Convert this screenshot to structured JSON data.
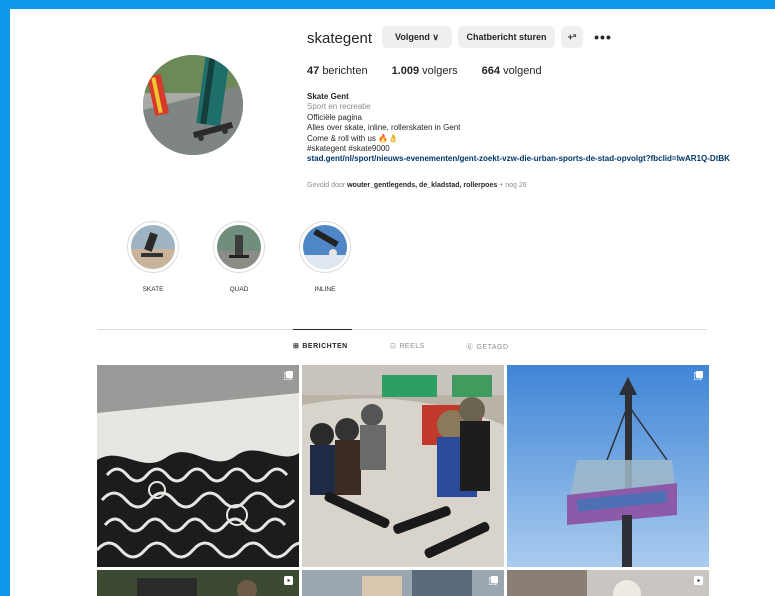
{
  "profile": {
    "username": "skategent",
    "follow_label": "Volgend ∨",
    "message_label": "Chatbericht sturen",
    "add_icon_glyph": "+ª",
    "more_icon_glyph": "•••",
    "stats": {
      "posts_count": "47",
      "posts_label": "berichten",
      "followers_count": "1.009",
      "followers_label": "volgers",
      "following_count": "664",
      "following_label": "volgend"
    },
    "bio": {
      "name": "Skate Gent",
      "category": "Sport en recreatie",
      "lines": [
        "Officiële pagina",
        "Alles over skate, inline, rollerskaten in Gent",
        "Come & roll with us 🔥👌",
        "#skategent #skate9000"
      ],
      "link": "stad.gent/nl/sport/nieuws-evenementen/gent-zoekt-vzw-die-urban-sports-de-stad-opvolgt?fbclid=IwAR1Q-DtBK"
    },
    "followed_by": {
      "prefix": "Gevold door",
      "names": "wouter_gentlegends, de_kladstad, rollerpoes",
      "suffix": "+ nog 26"
    }
  },
  "highlights": [
    {
      "label": "SKATE"
    },
    {
      "label": "QUAD"
    },
    {
      "label": "INLINE"
    }
  ],
  "tabs": [
    {
      "label": "BERICHTEN",
      "icon": "grid-icon",
      "glyph": "⊞"
    },
    {
      "label": "REELS",
      "icon": "reels-icon",
      "glyph": "⊡"
    },
    {
      "label": "GETAGD",
      "icon": "tagged-icon",
      "glyph": "Ⓖ"
    }
  ],
  "colors": {
    "frame_border": "#0d97e9",
    "link": "#00376b",
    "muted": "#8e8e8e",
    "button_bg": "#efefef"
  }
}
